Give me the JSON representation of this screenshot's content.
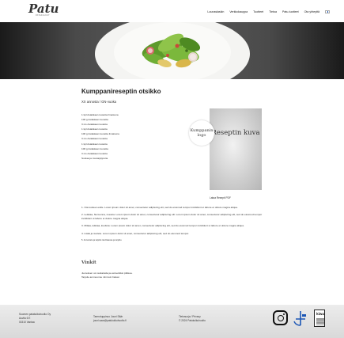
{
  "header": {
    "logo": "Patu",
    "logo_sub": "PATAKULKUT",
    "nav": [
      "Lounaslaskin",
      "Verkkokauppa",
      "Tuotteet",
      "Tietoa",
      "Patu-tuotteet",
      "Ota yhteyttä"
    ],
    "flag_icon": "finnish-flag-icon"
  },
  "recipe": {
    "title": "Kumppanireseptin otsikko",
    "subtitle": "XX annosta / GN-vuoka",
    "ingredients": [
      "1 kpl Asiakkaan tuotetta ilmaisuna",
      "100 g Asiakkaan tuotetta",
      "3 ms Asiakkaan tuotetta",
      "1 kpl Asiakkaan tuotetta",
      "100 g Asiakkaan tuotetta ilmaisuna",
      "3 ms Asiakkaan tuotetta",
      "1 kpl Asiakkaan tuotetta",
      "100 g Asiakkaan tuotetta",
      "3 ms Asiakkaan tuotetta",
      "Suolaa ja mustapippuria"
    ],
    "image_text": "Reseptin kuva",
    "partner_logo_text": "Kumppanin logo",
    "pdf_link": "Lataa Resepti PDF",
    "steps": [
      "1. Ota tuotteet esille. Lorem ipsum dolor sit amet, consectetur adipiscing elit, sed do eiusmod tempor incididunt ut labore et dolore magna aliqua.",
      "2. Leikkaa, Nenvonna, mausta. Lorem ipsum dolor sit amet, consectetur adipiscing elit. Lorem ipsum dolor sit amet, consectetur adipiscing elit, sed do eiusmod tempor incididunt ut labore et dolore magna aliqua.",
      "3. Mittaa, leikkaa, kuullota. Lorem ipsum dolor sit amet, consectetur adipiscing elit, sed do eiusmod tempor incididunt ut labore et dolore magna aliqua.",
      "4. Lisää ja nuoleta. Lorem ipsum dolor sit amet, consectetur adipiscing elit, sed do eiusmod tempor.",
      "5. Annostelu ja tarjoilu tarvittaessa ja tarjoilu."
    ],
    "tips_title": "Vinkit",
    "tips": [
      "Juureksen voi suikaloida ja esimerkiksi pilkkoa.",
      "Tarjoile ammoonne niin kuin haluat"
    ]
  },
  "footer": {
    "company": [
      "Suomen patakulkuhuolto Oy",
      "Auvila 6 E",
      "01510 Vantaa"
    ],
    "contact": [
      "Tarmotuppinuo Jouni Säär",
      "jouni.saar@patukulkuhuolto.fi"
    ],
    "legal": [
      "Tietosuoja / Privacy",
      "© 2024 Patukulkuhuolto"
    ],
    "icons": [
      "instagram-icon",
      "key-flag-certificate-icon",
      "kiwa-certificate-icon"
    ],
    "kiwa_label": "kiwa"
  },
  "colors": {
    "accent_blue": "#1c56b5",
    "footer_bg": "#e3e3e3",
    "text": "#222222"
  }
}
